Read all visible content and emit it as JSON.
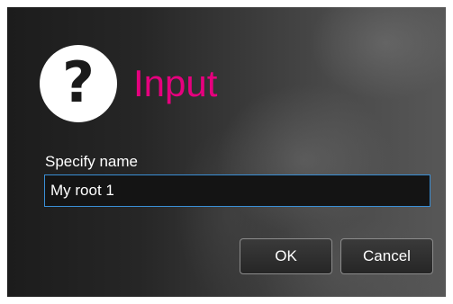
{
  "dialog": {
    "title": "Input",
    "icon": "question-mark-icon",
    "icon_glyph": "?",
    "title_color": "#e6007e",
    "field_label": "Specify name",
    "field_value": "My root 1",
    "ok_label": "OK",
    "cancel_label": "Cancel"
  }
}
